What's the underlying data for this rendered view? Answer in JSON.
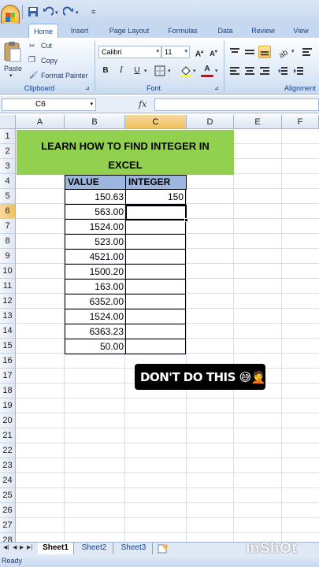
{
  "ribbon": {
    "tabs": [
      "Home",
      "Insert",
      "Page Layout",
      "Formulas",
      "Data",
      "Review",
      "View"
    ],
    "active_tab": "Home",
    "clipboard": {
      "paste": "Paste",
      "cut": "Cut",
      "copy": "Copy",
      "format_painter": "Format Painter",
      "label": "Clipboard"
    },
    "font": {
      "name": "Calibri",
      "size": "11",
      "label": "Font",
      "bold": "B",
      "italic": "I",
      "underline": "U",
      "grow": "A",
      "shrink": "A"
    },
    "alignment": {
      "label": "Alignment"
    }
  },
  "formula_bar": {
    "name_box": "C6",
    "fx": "fx",
    "formula": ""
  },
  "grid": {
    "columns": [
      "A",
      "B",
      "C",
      "D",
      "E",
      "F"
    ],
    "active_column": "C",
    "rows": [
      "1",
      "2",
      "3",
      "4",
      "5",
      "6",
      "7",
      "8",
      "9",
      "10",
      "11",
      "12",
      "13",
      "14",
      "15",
      "16",
      "17",
      "18",
      "19",
      "20",
      "21",
      "22",
      "23",
      "24",
      "25",
      "26",
      "27",
      "28"
    ],
    "active_row": "6"
  },
  "sheet": {
    "banner_line1": "LEARN HOW TO FIND INTEGER IN",
    "banner_line2": "EXCEL",
    "header_value": "VALUE",
    "header_integer": "INTEGER",
    "values": [
      "150.63",
      "563.00",
      "1524.00",
      "523.00",
      "4521.00",
      "1500.20",
      "163.00",
      "6352.00",
      "1524.00",
      "6363.23",
      "50.00"
    ],
    "integers": [
      "150",
      "",
      "",
      "",
      "",
      "",
      "",
      "",
      "",
      "",
      ""
    ],
    "banner_color": "#92d050",
    "header_color": "#9bb7df"
  },
  "sticker": {
    "text": "DON'T DO THIS",
    "emoji": "😅🤦"
  },
  "sheet_tabs": [
    "Sheet1",
    "Sheet2",
    "Sheet3"
  ],
  "active_sheet": "Sheet1",
  "status": "Ready",
  "watermark": "InShOt"
}
